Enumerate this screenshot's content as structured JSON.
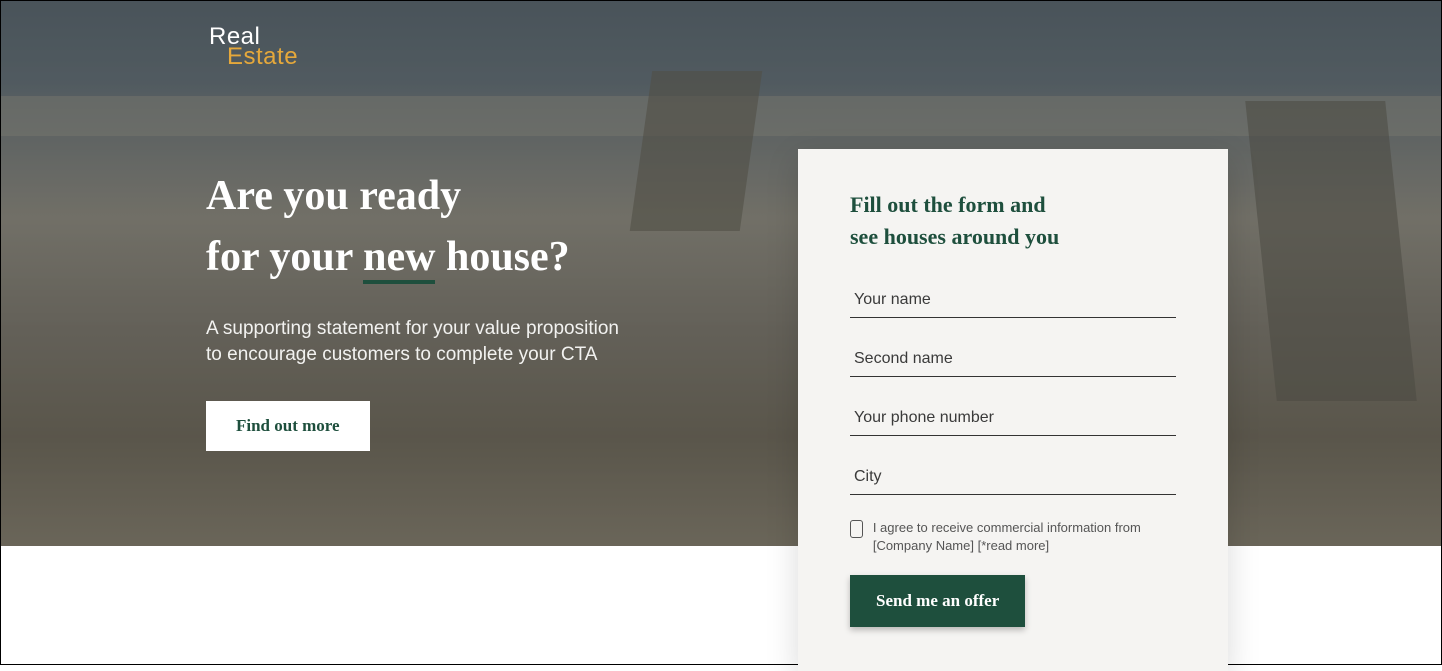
{
  "logo": {
    "line1": "Real",
    "line2": "Estate"
  },
  "hero": {
    "headline_line1": "Are you ready",
    "headline_line2_pre": "for your ",
    "headline_line2_underlined": "new",
    "headline_line2_post": " house?",
    "subhead": "A supporting statement for your value proposition to encourage customers to complete your CTA",
    "cta_label": "Find out more"
  },
  "form": {
    "title_line1": "Fill out the form and",
    "title_line2": "see houses around you",
    "fields": {
      "name_placeholder": "Your name",
      "second_name_placeholder": "Second name",
      "phone_placeholder": "Your phone number",
      "city_placeholder": "City"
    },
    "consent_text": "I agree to receive commercial information from [Company Name] [*read more]",
    "submit_label": "Send me an offer"
  }
}
